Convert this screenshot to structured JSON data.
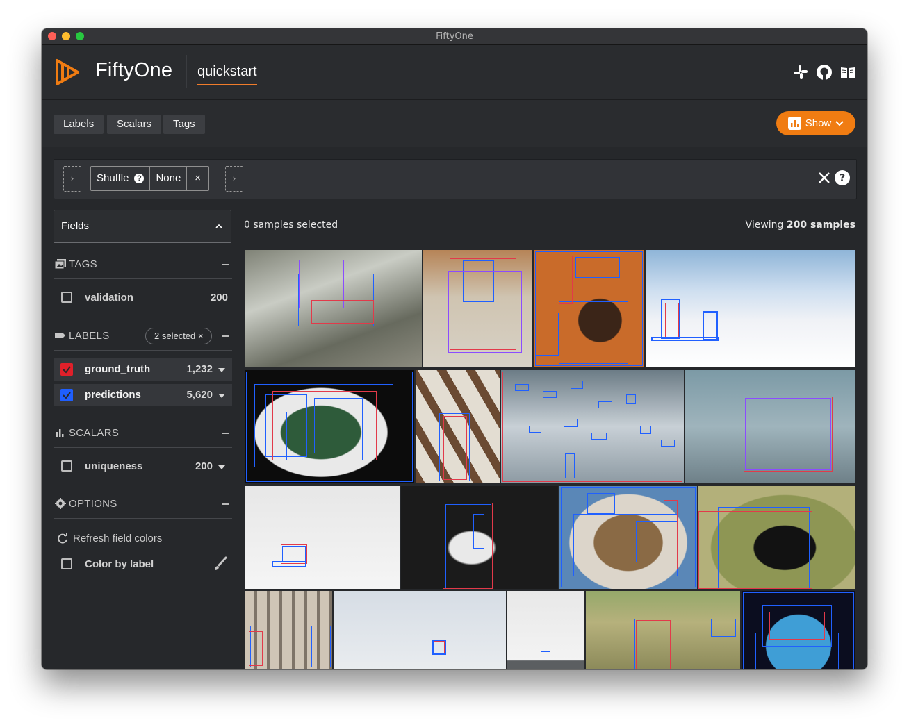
{
  "window": {
    "title": "FiftyOne"
  },
  "header": {
    "brand": "FiftyOne",
    "dataset": "quickstart",
    "icons": [
      "slack-icon",
      "github-icon",
      "docs-book-icon"
    ]
  },
  "toolbar": {
    "tabs": [
      "Labels",
      "Scalars",
      "Tags"
    ],
    "show_label": "Show"
  },
  "view_bar": {
    "stage_name": "Shuffle",
    "stage_value": "None",
    "close_symbol": "×",
    "help_symbol": "?"
  },
  "sidebar": {
    "fields_label": "Fields",
    "tags": {
      "title": "TAGS",
      "items": [
        {
          "name": "validation",
          "count": "200",
          "checked": false
        }
      ]
    },
    "labels": {
      "title": "LABELS",
      "selected_pill": "2 selected ×",
      "items": [
        {
          "name": "ground_truth",
          "count": "1,232",
          "checked": true,
          "color": "#e0202a"
        },
        {
          "name": "predictions",
          "count": "5,620",
          "checked": true,
          "color": "#1f5fff"
        }
      ]
    },
    "scalars": {
      "title": "SCALARS",
      "items": [
        {
          "name": "uniqueness",
          "count": "200",
          "checked": false
        }
      ]
    },
    "options": {
      "title": "OPTIONS",
      "refresh_label": "Refresh field colors",
      "color_by_label": "Color by label"
    }
  },
  "content": {
    "selected_text": "0 samples selected",
    "viewing_prefix": "Viewing",
    "viewing_count": "200 samples"
  },
  "colors": {
    "accent": "#f07c12",
    "ground_truth": "#e0202a",
    "predictions": "#1f5fff",
    "background": "#26282b"
  },
  "samples": [
    {
      "id": "surfer"
    },
    {
      "id": "motorcycle-officer"
    },
    {
      "id": "dinner-plate"
    },
    {
      "id": "snow-skiers"
    },
    {
      "id": "green-beans-plate"
    },
    {
      "id": "pavilion-person"
    },
    {
      "id": "beach-birds"
    },
    {
      "id": "elephant"
    },
    {
      "id": "snow-slope"
    },
    {
      "id": "tennis-player"
    },
    {
      "id": "fish-broccoli"
    },
    {
      "id": "black-cat"
    },
    {
      "id": "bathroom"
    },
    {
      "id": "kite-sky"
    },
    {
      "id": "kite-surf"
    },
    {
      "id": "zebras"
    },
    {
      "id": "cake"
    }
  ]
}
